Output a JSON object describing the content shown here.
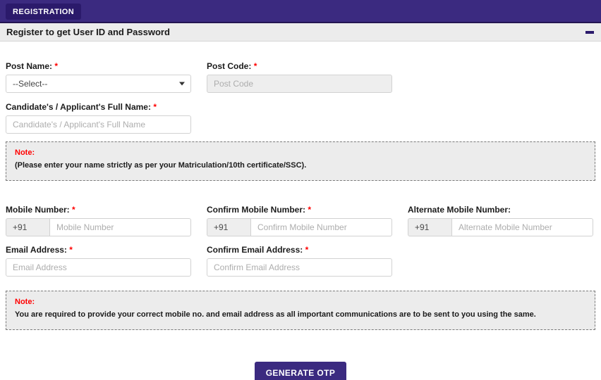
{
  "topbar": {
    "tab_label": "REGISTRATION"
  },
  "panel": {
    "title": "Register to get User ID and Password",
    "collapse_icon": "minus-icon"
  },
  "fields": {
    "post_name": {
      "label": "Post Name:",
      "required": "*",
      "selected": "--Select--",
      "caret_icon": "chevron-down-icon"
    },
    "post_code": {
      "label": "Post Code:",
      "required": "*",
      "placeholder": "Post Code",
      "value": ""
    },
    "full_name": {
      "label": "Candidate's / Applicant's Full Name:",
      "required": "*",
      "placeholder": "Candidate's / Applicant's Full Name",
      "value": ""
    },
    "mobile": {
      "label": "Mobile Number:",
      "required": "*",
      "prefix": "+91",
      "placeholder": "Mobile Number",
      "value": ""
    },
    "confirm_mobile": {
      "label": "Confirm Mobile Number:",
      "required": "*",
      "prefix": "+91",
      "placeholder": "Confirm Mobile Number",
      "value": ""
    },
    "alternate_mobile": {
      "label": "Alternate Mobile Number:",
      "required": "",
      "prefix": "+91",
      "placeholder": "Alternate Mobile Number",
      "value": ""
    },
    "email": {
      "label": "Email Address:",
      "required": "*",
      "placeholder": "Email Address",
      "value": ""
    },
    "confirm_email": {
      "label": "Confirm Email Address:",
      "required": "*",
      "placeholder": "Confirm Email Address",
      "value": ""
    }
  },
  "notes": {
    "name_note": {
      "title": "Note:",
      "text": "(Please enter your name strictly as per your Matriculation/10th certificate/SSC)."
    },
    "contact_note": {
      "title": "Note:",
      "text": "You are required to provide your correct mobile no. and email address as all important communications are to be sent to you using the same."
    }
  },
  "actions": {
    "generate_otp": "GENERATE OTP"
  },
  "colors": {
    "brand_purple": "#3b2a80",
    "tab_purple": "#2b1a6b",
    "required_red": "#ff0000",
    "note_bg": "#ececec",
    "disabled_bg": "#eeeeee"
  }
}
